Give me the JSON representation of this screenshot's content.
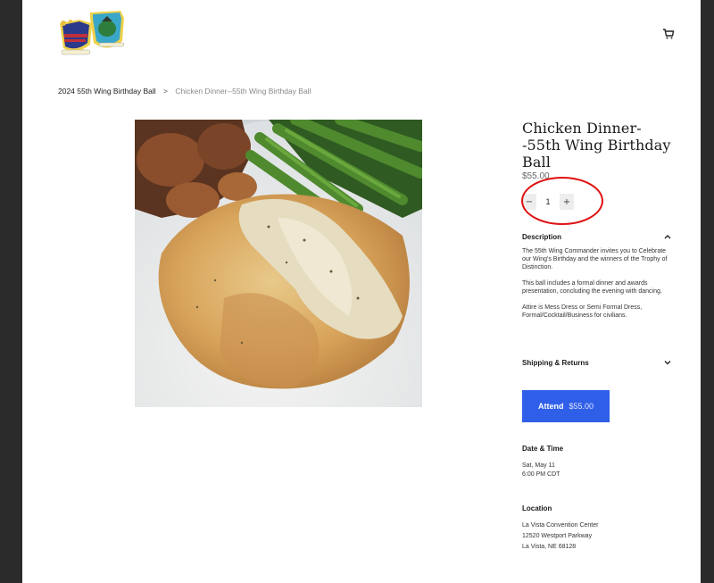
{
  "header": {
    "logo_icon": "wing-logo-icon",
    "cart_icon": "cart-icon"
  },
  "breadcrumb": {
    "parent": "2024 55th Wing Birthday Ball",
    "separator": ">",
    "current": "Chicken Dinner--55th Wing Birthday Ball"
  },
  "product": {
    "title": "Chicken Dinner--55th Wing Birthday Ball",
    "price": "$55.00",
    "quantity": "1",
    "decrement_label": "−",
    "increment_label": "+",
    "description": {
      "label": "Description",
      "paragraphs": [
        "The 55th Wing Commander invites you to Celebrate our Wing's Birthday and the winners of the Trophy of Distinction.",
        "This ball includes a formal dinner and awards presentation, concluding the evening with dancing.",
        "Attire is Mess Dress or Semi Formal Dress, Formal/Cocktail/Business for civilians."
      ]
    },
    "shipping": {
      "label": "Shipping & Returns"
    },
    "attend_button": {
      "label": "Attend",
      "price": "$55.00"
    },
    "date_time": {
      "label": "Date & Time",
      "date": "Sat, May 11",
      "time": "6:00 PM CDT"
    },
    "location": {
      "label": "Location",
      "venue": "La Vista Convention Center",
      "street": "12520 Westport Parkway",
      "city": "La Vista, NE 68128"
    }
  },
  "colors": {
    "accent": "#2f5fe8",
    "highlight_circle": "#e01010"
  }
}
